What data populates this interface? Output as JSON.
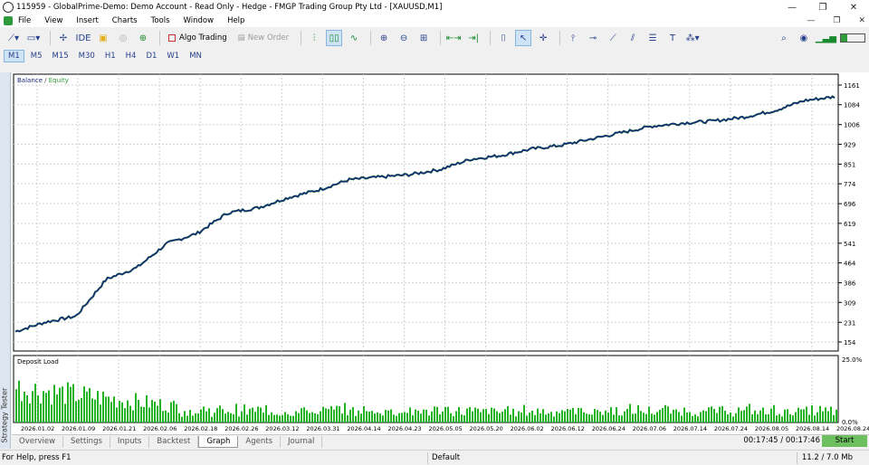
{
  "window": {
    "title": "115959 - GlobalPrime-Demo: Demo Account - Read Only - Hedge - FMGP Trading Group Pty Ltd - [XAUUSD,M1]",
    "minimize": "—",
    "restore": "❐",
    "close": "✕"
  },
  "menu": {
    "items": [
      "File",
      "View",
      "Insert",
      "Charts",
      "Tools",
      "Window",
      "Help"
    ],
    "right_min": "—",
    "right_restore": "❐",
    "right_close": "✕"
  },
  "toolbar": {
    "algo_trading": "Algo Trading",
    "new_order": "New Order",
    "icons": [
      "line-chart-icon",
      "chart-type-icon",
      "chart-shift-icon",
      "ide-icon",
      "lock-icon",
      "signal-icon",
      "globe-icon",
      "algo-trading-icon",
      "new-order-icon",
      "bar-chart-icon",
      "candles-icon",
      "line-icon",
      "zoom-in-icon",
      "zoom-out-icon",
      "grid-icon",
      "autoscroll-icon",
      "chart-shift-icon-2",
      "screenshot-icon",
      "cursor-icon",
      "crosshair-icon",
      "vertical-line-icon",
      "horizontal-line-icon",
      "trend-line-icon",
      "channel-icon",
      "fibo-icon",
      "text-icon",
      "shapes-icon",
      "search-icon",
      "account-icon",
      "signal-strength-icon",
      "battery-icon"
    ]
  },
  "timeframes": [
    "M1",
    "M5",
    "M15",
    "M30",
    "H1",
    "H4",
    "D1",
    "W1",
    "MN"
  ],
  "selected_timeframe": "M1",
  "side_panel_label": "Strategy Tester",
  "chart": {
    "legend_balance": "Balance",
    "legend_sep": " / ",
    "legend_equity": "Equity",
    "deposit_load_label": "Deposit Load",
    "balance_color": "#1a2a7a",
    "equity_color": "#2e9b3a",
    "deposit_color": "#22b322"
  },
  "chart_data": [
    {
      "type": "line",
      "series": [
        {
          "name": "Balance",
          "values": [
            195,
            232,
            255,
            400,
            445,
            540,
            580,
            660,
            680,
            720,
            750,
            790,
            800,
            810,
            830,
            870,
            885,
            910,
            925,
            950,
            975,
            1000,
            1012,
            1020,
            1035,
            1060,
            1100,
            1115
          ]
        },
        {
          "name": "Equity",
          "values": [
            195,
            232,
            255,
            400,
            445,
            540,
            580,
            660,
            680,
            720,
            750,
            790,
            800,
            810,
            830,
            870,
            885,
            910,
            925,
            950,
            975,
            1000,
            1012,
            1020,
            1035,
            1060,
            1100,
            1115
          ]
        }
      ],
      "x": [
        "2026.01.02",
        "2026.01.09",
        "2026.01.21",
        "2026.02.06",
        "2026.02.18",
        "2026.02.26",
        "2026.03.12",
        "2026.03.31",
        "2026.04.14",
        "2026.04.23",
        "2026.05.05",
        "2026.05.20",
        "2026.06.02",
        "2026.06.12",
        "2026.06.24",
        "2026.07.06",
        "2026.07.14",
        "2026.07.24",
        "2026.08.05",
        "2026.08.14",
        "2026.08.24"
      ],
      "y_ticks": [
        "1161",
        "1084",
        "1006",
        "929",
        "851",
        "774",
        "696",
        "619",
        "541",
        "464",
        "386",
        "309",
        "231",
        "154"
      ],
      "ylim": [
        154,
        1161
      ],
      "grid": true
    },
    {
      "type": "bar",
      "title": "Deposit Load",
      "y_ticks": [
        "25.0%",
        "0.0%"
      ],
      "ylim": [
        0,
        25
      ]
    }
  ],
  "tabs": [
    "Overview",
    "Settings",
    "Inputs",
    "Backtest",
    "Graph",
    "Agents",
    "Journal"
  ],
  "selected_tab": "Graph",
  "timer": "00:17:45 / 00:17:46",
  "start_button": "Start",
  "status": {
    "help": "For Help, press F1",
    "profile": "Default",
    "memory": "11.2 / 7.0 Mb"
  }
}
